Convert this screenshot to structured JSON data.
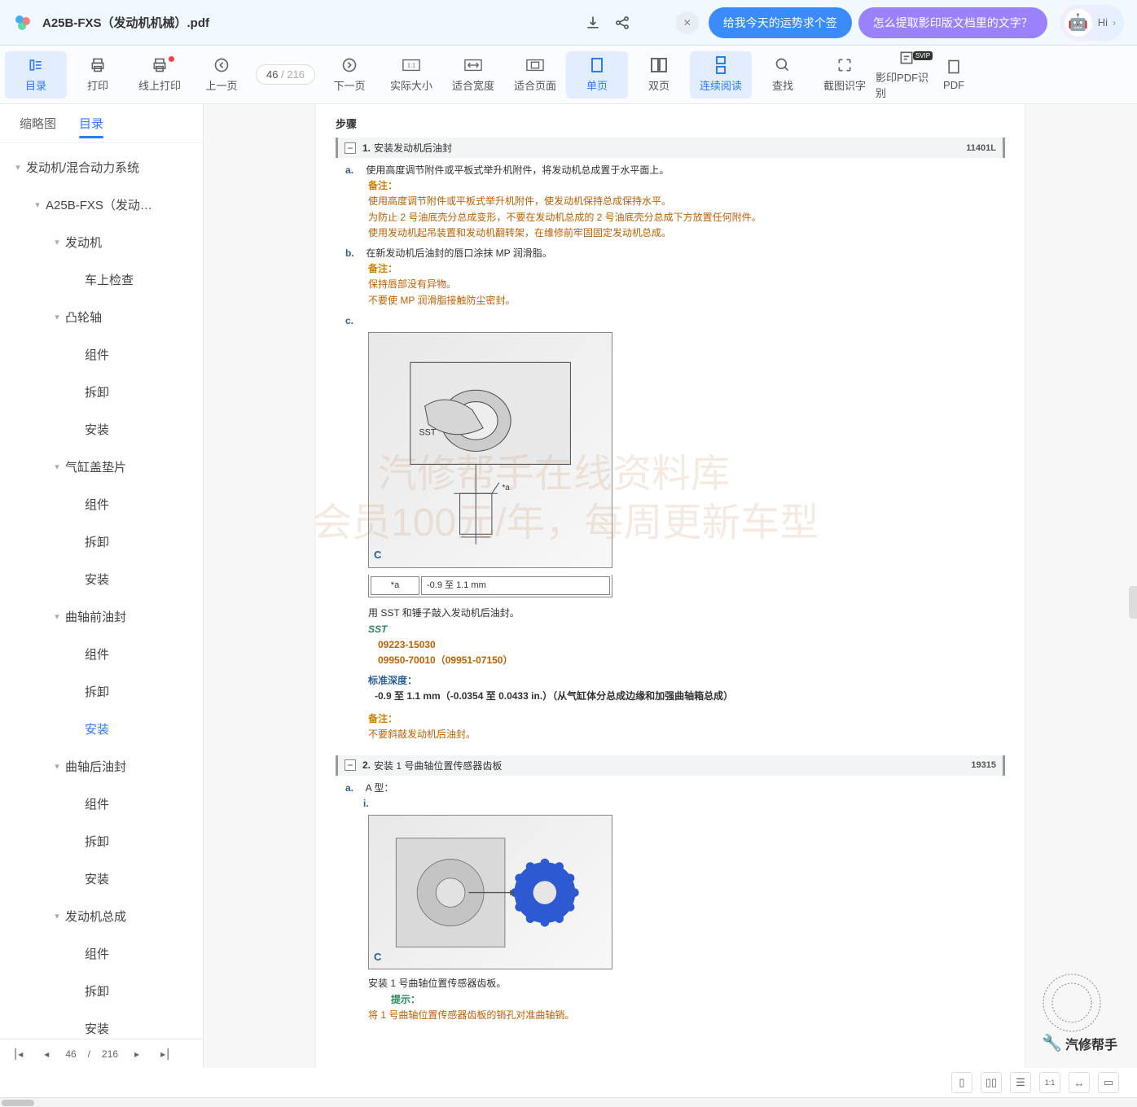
{
  "header": {
    "title": "A25B-FXS（发动机机械）.pdf",
    "pills": [
      "给我今天的运势求个签",
      "怎么提取影印版文档里的文字？"
    ],
    "hi": "Hi"
  },
  "toolbar": {
    "items": [
      {
        "label": "目录",
        "icon": "toc"
      },
      {
        "label": "打印",
        "icon": "print"
      },
      {
        "label": "线上打印",
        "icon": "cloud-print",
        "dot": true
      },
      {
        "label": "上一页",
        "icon": "prev"
      },
      {
        "label": "下一页",
        "icon": "next"
      },
      {
        "label": "实际大小",
        "icon": "1-1"
      },
      {
        "label": "适合宽度",
        "icon": "fit-w"
      },
      {
        "label": "适合页面",
        "icon": "fit-p"
      },
      {
        "label": "单页",
        "icon": "single"
      },
      {
        "label": "双页",
        "icon": "double"
      },
      {
        "label": "连续阅读",
        "icon": "cont"
      },
      {
        "label": "查找",
        "icon": "search"
      },
      {
        "label": "截图识字",
        "icon": "crop"
      },
      {
        "label": "影印PDF识别",
        "icon": "ocr",
        "svip": true
      },
      {
        "label": "PDF",
        "icon": "pdf"
      }
    ],
    "page": {
      "current": "46",
      "sep": "/",
      "total": "216"
    }
  },
  "side": {
    "tabs": [
      "缩略图",
      "目录"
    ],
    "tree": [
      {
        "label": "发动机/混合动力系统",
        "indent": 0,
        "arrow": true
      },
      {
        "label": "A25B-FXS（发动…",
        "indent": 1,
        "arrow": true
      },
      {
        "label": "发动机",
        "indent": 2,
        "arrow": true
      },
      {
        "label": "车上检查",
        "indent": 3
      },
      {
        "label": "凸轮轴",
        "indent": 2,
        "arrow": true
      },
      {
        "label": "组件",
        "indent": 3
      },
      {
        "label": "拆卸",
        "indent": 3
      },
      {
        "label": "安装",
        "indent": 3
      },
      {
        "label": "气缸盖垫片",
        "indent": 2,
        "arrow": true
      },
      {
        "label": "组件",
        "indent": 3
      },
      {
        "label": "拆卸",
        "indent": 3
      },
      {
        "label": "安装",
        "indent": 3
      },
      {
        "label": "曲轴前油封",
        "indent": 2,
        "arrow": true
      },
      {
        "label": "组件",
        "indent": 3
      },
      {
        "label": "拆卸",
        "indent": 3
      },
      {
        "label": "安装",
        "indent": 3,
        "sel": true
      },
      {
        "label": "曲轴后油封",
        "indent": 2,
        "arrow": true
      },
      {
        "label": "组件",
        "indent": 3
      },
      {
        "label": "拆卸",
        "indent": 3
      },
      {
        "label": "安装",
        "indent": 3
      },
      {
        "label": "发动机总成",
        "indent": 2,
        "arrow": true
      },
      {
        "label": "组件",
        "indent": 3
      },
      {
        "label": "拆卸",
        "indent": 3
      },
      {
        "label": "安装",
        "indent": 3
      }
    ]
  },
  "doc": {
    "steps_title": "步骤",
    "section1": {
      "num": "1.",
      "title": "安装发动机后油封",
      "code": "11401L"
    },
    "stepA": {
      "label": "a.",
      "text": "使用高度调节附件或平板式举升机附件，将发动机总成置于水平面上。",
      "note_label": "备注：",
      "notes": [
        "使用高度调节附件或平板式举升机附件，使发动机保持总成保持水平。",
        "为防止 2 号油底壳分总成变形，不要在发动机总成的 2 号油底壳分总成下方放置任何附件。",
        "使用发动机起吊装置和发动机翻转架，在维修前牢固固定发动机总成。"
      ]
    },
    "stepB": {
      "label": "b.",
      "text": "在新发动机后油封的唇口涂抹 MP 润滑脂。",
      "note_label": "备注：",
      "notes": [
        "保持唇部没有异物。",
        "不要使 MP 润滑脂接触防尘密封。"
      ]
    },
    "stepC": {
      "label": "c.",
      "fig_c": "C",
      "fig_sst": "SST",
      "table": {
        "key": "*a",
        "val": "-0.9 至 1.1 mm"
      },
      "body": "用 SST 和锤子敲入发动机后油封。",
      "sst_label": "SST",
      "sst1": "09223-15030",
      "sst2": "09950-70010（09951-07150）",
      "depth_label": "标准深度：",
      "depth_val": "-0.9 至 1.1 mm（-0.0354 至 0.0433 in.）（从气缸体分总成边缘和加强曲轴箱总成）",
      "note_label": "备注：",
      "note": "不要斜敲发动机后油封。"
    },
    "section2": {
      "num": "2.",
      "title": "安装 1 号曲轴位置传感器齿板",
      "code": "19315"
    },
    "stepA2": {
      "label": "a.",
      "sub": "i.",
      "atype": "A 型：",
      "fig_c": "C",
      "body": "安装 1 号曲轴位置传感器齿板。",
      "tip_label": "提示：",
      "tip": "将 1 号曲轴位置传感器齿板的销孔对准曲轴销。"
    },
    "watermark1": "汽修帮手在线资料库",
    "watermark2": "会员100元/年，每周更新车型",
    "brand": "汽修帮手"
  },
  "footer": {
    "page": {
      "cur": "46",
      "sep": "/",
      "total": "216"
    }
  }
}
